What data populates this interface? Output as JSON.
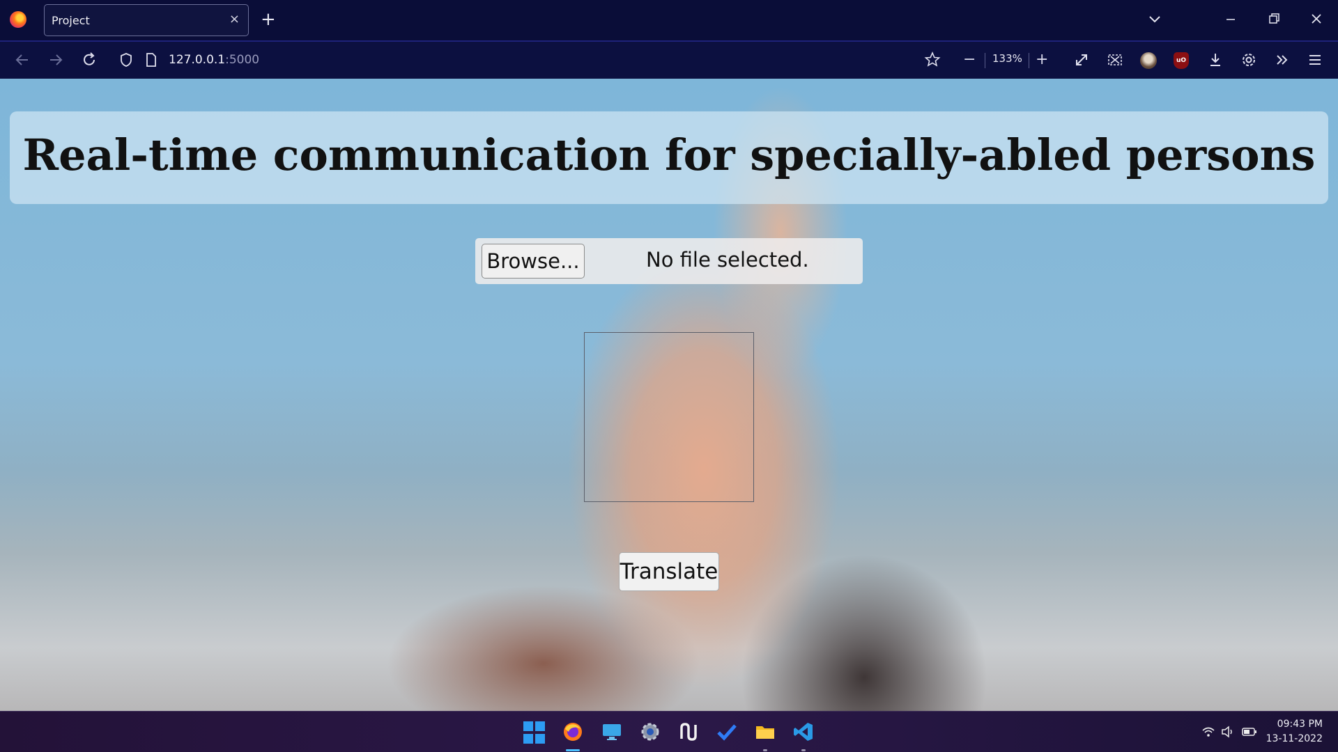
{
  "browser": {
    "tab_title": "Project",
    "tab_close": "×",
    "new_tab": "+",
    "url_host": "127.0.0.1",
    "url_port": ":5000",
    "zoom_level": "133%",
    "zoom_out": "−",
    "zoom_in": "+"
  },
  "page": {
    "title": "Real-time communication for specially-abled persons",
    "browse_label": "Browse...",
    "file_status": "No file selected.",
    "translate_label": "Translate"
  },
  "taskbar": {
    "time": "09:43 PM",
    "date": "13-11-2022",
    "accent": "#2d9cf3"
  }
}
